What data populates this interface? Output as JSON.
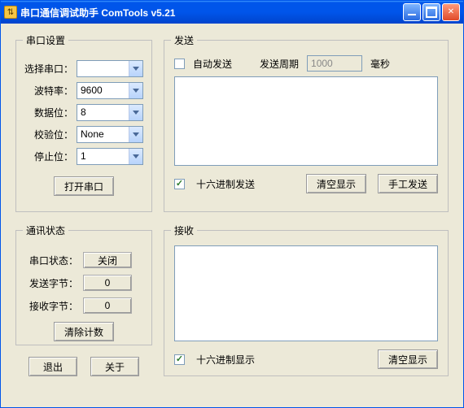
{
  "window": {
    "title": "串口通信调试助手 ComTools v5.21"
  },
  "port": {
    "legend": "串口设置",
    "select_port_label": "选择串口：",
    "select_port_value": "",
    "baud_label": "波特率：",
    "baud_value": "9600",
    "data_bits_label": "数据位：",
    "data_bits_value": "8",
    "parity_label": "校验位：",
    "parity_value": "None",
    "stop_bits_label": "停止位：",
    "stop_bits_value": "1",
    "open_button": "打开串口"
  },
  "comm": {
    "legend": "通讯状态",
    "port_status_label": "串口状态：",
    "port_status_value": "关闭",
    "sent_label": "发送字节：",
    "sent_value": "0",
    "recv_label": "接收字节：",
    "recv_value": "0",
    "clear_button": "清除计数"
  },
  "bottom": {
    "exit": "退出",
    "about": "关于"
  },
  "send": {
    "legend": "发送",
    "auto_send": "自动发送",
    "period_label": "发送周期",
    "period_value": "1000",
    "period_unit": "毫秒",
    "hex_send": "十六进制发送",
    "clear": "清空显示",
    "manual": "手工发送"
  },
  "recv": {
    "legend": "接收",
    "hex_display": "十六进制显示",
    "clear": "清空显示"
  }
}
